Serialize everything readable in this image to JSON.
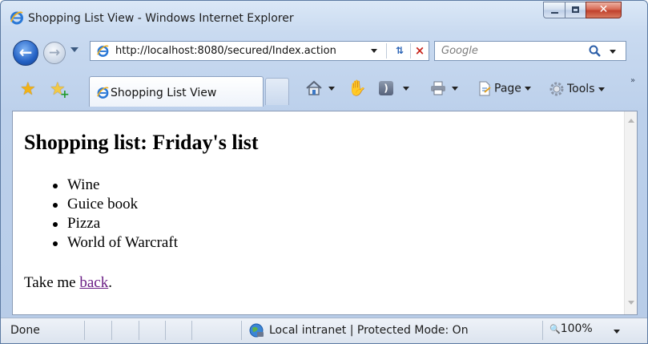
{
  "window": {
    "title": "Shopping List View - Windows Internet Explorer",
    "controls": {
      "minimize": "–",
      "maximize": "□",
      "close": "✕"
    }
  },
  "navigation": {
    "address": "http://localhost:8080/secured/Index.action",
    "search_placeholder": "Google"
  },
  "tabs": {
    "active_label": "Shopping List View"
  },
  "command_bar": {
    "page_label": "Page",
    "tools_label": "Tools",
    "more_glyph": "»"
  },
  "page": {
    "heading": "Shopping list: Friday's list",
    "items": [
      "Wine",
      "Guice book",
      "Pizza",
      "World of Warcraft"
    ],
    "back_prefix": "Take me ",
    "back_link": "back",
    "back_suffix": "."
  },
  "status_bar": {
    "status": "Done",
    "zone": "Local intranet | Protected Mode: On",
    "zoom": "100%"
  },
  "colors": {
    "link_visited": "#6b1f85",
    "chrome": "#c9daf0",
    "close_button": "#c0412c"
  },
  "icons": {
    "back": "back-arrow-icon",
    "forward": "forward-arrow-icon",
    "favorites": "star-icon",
    "add_favorite": "star-plus-icon",
    "home": "home-icon",
    "research": "hand-icon",
    "feeds": "rss-icon",
    "print": "printer-icon",
    "page": "page-icon",
    "tools": "gear-icon",
    "zone": "globe-icon"
  }
}
